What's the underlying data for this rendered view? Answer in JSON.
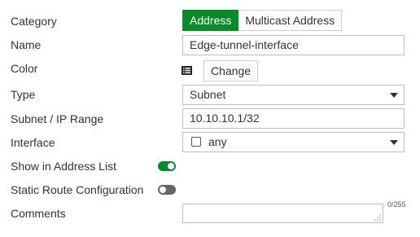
{
  "labels": {
    "category": "Category",
    "name": "Name",
    "color": "Color",
    "type": "Type",
    "subnet": "Subnet / IP Range",
    "interface": "Interface",
    "show_in_list": "Show in Address List",
    "static_route": "Static Route Configuration",
    "comments": "Comments"
  },
  "category": {
    "options": [
      "Address",
      "Multicast Address"
    ],
    "selected": "Address"
  },
  "name_value": "Edge-tunnel-interface",
  "color": {
    "change_label": "Change",
    "icon": "color-swatch-icon"
  },
  "type": {
    "selected": "Subnet"
  },
  "subnet_value": "10.10.10.1/32",
  "interface": {
    "selected": "any"
  },
  "toggles": {
    "show_in_list": true,
    "static_route": false
  },
  "comments": {
    "value": "",
    "counter": "0/255"
  },
  "colors": {
    "accent": "#0b8a2c",
    "toggle_off": "#666666",
    "border": "#bdbdbd"
  }
}
